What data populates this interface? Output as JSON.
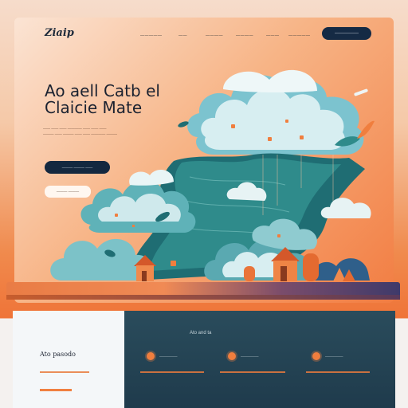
{
  "nav": {
    "logo": "Ziaip",
    "links": [
      "—————",
      "——",
      "————",
      "————",
      "———",
      "—————"
    ],
    "cta": "——————"
  },
  "hero": {
    "headline_line1": "Ao aell Catb el",
    "headline_line2": "Claicie Mate",
    "subtext_lines": [
      "—— —— —— ———— —— —— ——",
      "——— —— ——— —— —— ———— ———"
    ],
    "primary_button": "——— ——— ——",
    "secondary_button": "——— ———"
  },
  "footer": {
    "section_title": "Ato and ta",
    "left_title": "Ato pasodo",
    "features": [
      {
        "icon": "orange-circle-icon",
        "label": "—————"
      },
      {
        "icon": "orange-circle-icon",
        "label": "—————"
      },
      {
        "icon": "orange-circle-icon",
        "label": "—————"
      }
    ]
  },
  "colors": {
    "accent": "#f07e3e",
    "navy": "#14283f",
    "teal": "#2a7a84"
  }
}
